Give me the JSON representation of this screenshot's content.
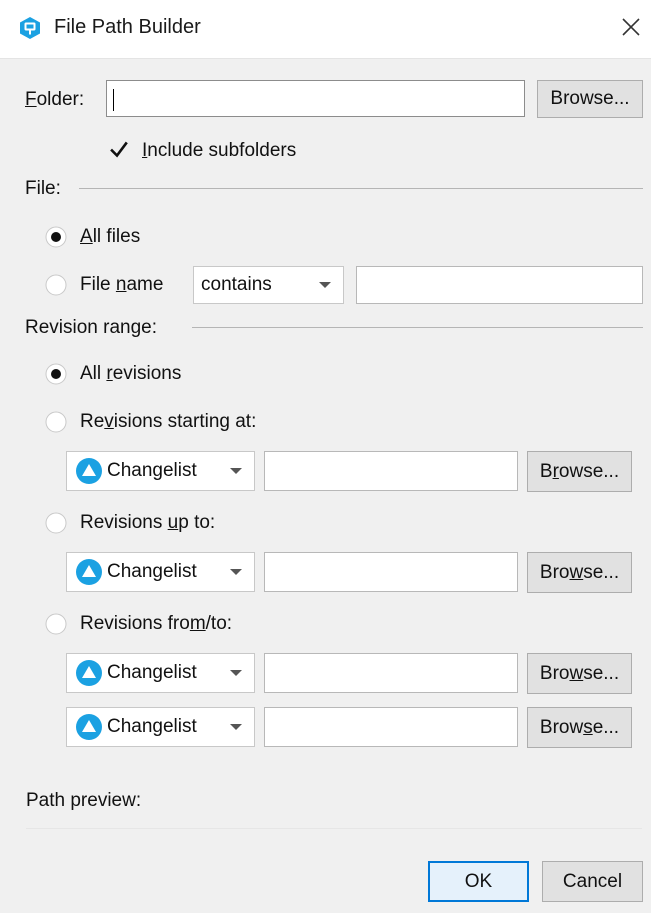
{
  "window": {
    "title": "File Path Builder"
  },
  "folder": {
    "label_u": "F",
    "label_rest": "older:",
    "value": "",
    "browse_label": "Browse...",
    "include_u": "I",
    "include_rest": "nclude subfolders",
    "include_checked": true
  },
  "file": {
    "section_label": "File:",
    "all_files_u": "A",
    "all_files_rest": "ll files",
    "all_files_selected": true,
    "file_name_pre": "File ",
    "file_name_u": "n",
    "file_name_rest": "ame",
    "match_mode": "contains",
    "name_value": ""
  },
  "revision": {
    "section_label": "Revision range:",
    "all_pre": "All ",
    "all_u": "r",
    "all_rest": "evisions",
    "starting_pre": "Re",
    "starting_u": "v",
    "starting_rest": "isions starting at:",
    "upto_pre": "Revisions ",
    "upto_u": "u",
    "upto_rest": "p to:",
    "fromto_pre": "Revisions fro",
    "fromto_u": "m",
    "fromto_rest": "/to:",
    "selected": "all",
    "combos": [
      {
        "label": "Changelist",
        "browse_pre": "B",
        "browse_u": "r",
        "browse_rest": "owse..."
      },
      {
        "label": "Changelist",
        "browse_pre": "Bro",
        "browse_u": "w",
        "browse_rest": "se..."
      },
      {
        "label": "Changelist",
        "browse_pre": "Bro",
        "browse_u": "w",
        "browse_rest": "se..."
      },
      {
        "label": "Changelist",
        "browse_pre": "Brow",
        "browse_u": "s",
        "browse_rest": "e..."
      }
    ]
  },
  "preview": {
    "label": "Path preview:",
    "value": ""
  },
  "actions": {
    "ok": "OK",
    "cancel": "Cancel"
  },
  "colors": {
    "accent": "#0078d7",
    "changelist_icon": "#1ba1e2",
    "app_icon": "#1ba1e2"
  },
  "icons": [
    "app-icon",
    "close-icon",
    "checkmark-icon",
    "radio-icon",
    "changelist-icon",
    "chevron-down-icon"
  ]
}
